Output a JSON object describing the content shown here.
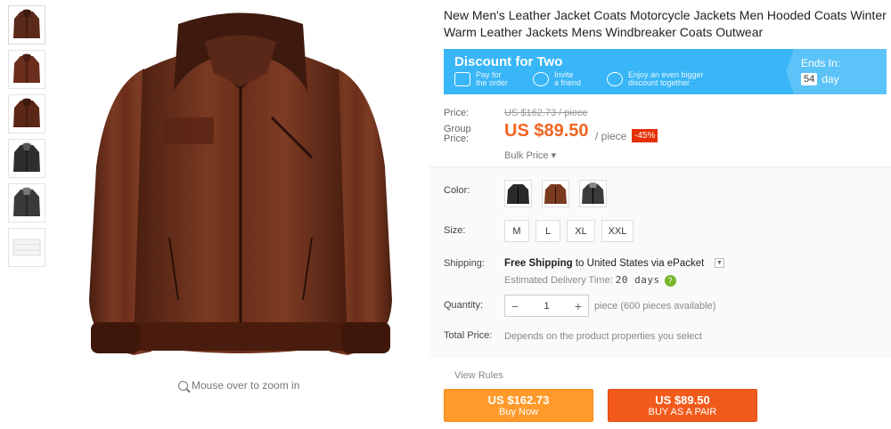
{
  "product": {
    "title": "New Men's Leather Jacket Coats Motorcycle Jackets Men Hooded Coats Winter Warm Leather Jackets Mens Windbreaker Coats Outwear"
  },
  "gallery": {
    "zoom_hint": "Mouse over to zoom in",
    "thumbnail_colors": [
      "#5a2a1a",
      "#6b2e1c",
      "#5a2616",
      "#2e2e30",
      "#3a3a3a",
      "#f4f4f4"
    ]
  },
  "promo": {
    "title": "Discount for Two",
    "step1_line1": "Pay for",
    "step1_line2": "the order",
    "step2_line1": "Invite",
    "step2_line2": "a friend",
    "step3_line1": "Enjoy an even bigger",
    "step3_line2": "discount together",
    "ends_label": "Ends In:",
    "days_value": "54",
    "days_label": "day"
  },
  "pricing": {
    "price_label": "Price:",
    "old_price": "US $162.73 / piece",
    "group_label_1": "Group",
    "group_label_2": "Price:",
    "group_price": "US $89.50",
    "unit": "/ piece",
    "discount": "-45%",
    "bulk_price": "Bulk Price ▾"
  },
  "options": {
    "color_label": "Color:",
    "colors": [
      "black",
      "brown",
      "gray"
    ],
    "size_label": "Size:",
    "sizes": [
      "M",
      "L",
      "XL",
      "XXL"
    ]
  },
  "shipping": {
    "label": "Shipping:",
    "free_text": "Free Shipping",
    "to_text": " to ",
    "destination": "United States via ePacket",
    "eta_label": "Estimated Delivery Time:",
    "eta_value": "20 days",
    "help": "?"
  },
  "quantity": {
    "label": "Quantity:",
    "value": "1",
    "minus": "−",
    "plus": "+",
    "note": "piece (600 pieces available)"
  },
  "total": {
    "label": "Total Price:",
    "note": "Depends on the product properties you select"
  },
  "actions": {
    "view_rules": "View Rules",
    "buy_now_price": "US $162.73",
    "buy_now_label": "Buy Now",
    "buy_pair_price": "US $89.50",
    "buy_pair_label": "BUY AS A PAIR"
  },
  "colors": {
    "promo_blue": "#38b6f7",
    "price_orange": "#f26522",
    "discount_red": "#e62e04",
    "buy_now": "#ff9a2b",
    "buy_pair": "#f25a1c",
    "jacket_brown": "#6b2e1c"
  }
}
